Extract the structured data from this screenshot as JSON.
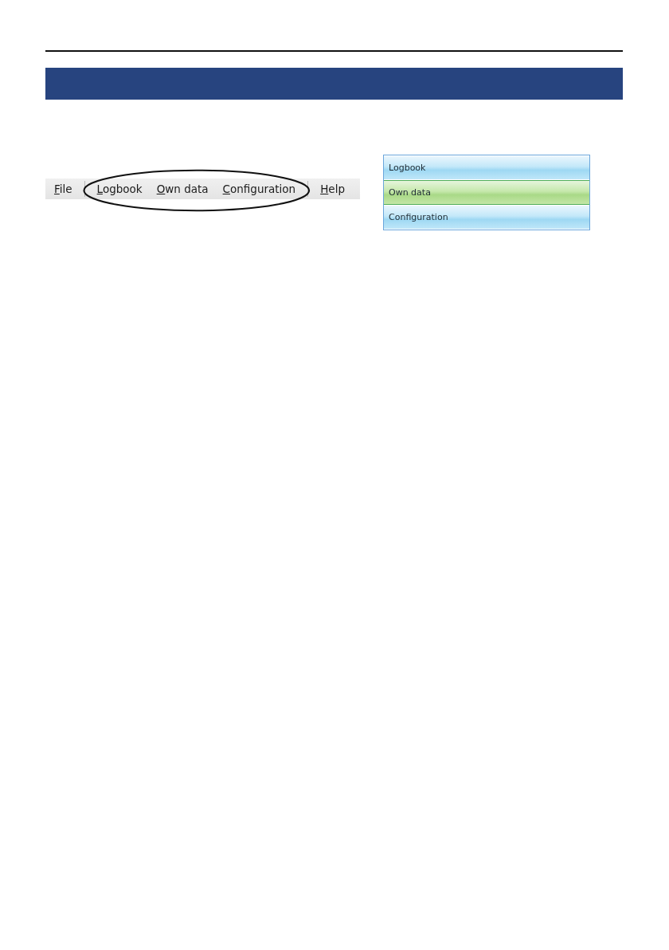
{
  "menu_bar": {
    "items": [
      {
        "label": "File"
      },
      {
        "label": "Logbook",
        "circled": true
      },
      {
        "label": "Own data",
        "circled": true
      },
      {
        "label": "Configuration",
        "circled": true
      },
      {
        "label": "Help"
      }
    ]
  },
  "side_menu": {
    "items": [
      {
        "label": "Logbook",
        "selected": false
      },
      {
        "label": "Own data",
        "selected": true
      },
      {
        "label": "Configuration",
        "selected": false
      }
    ]
  }
}
